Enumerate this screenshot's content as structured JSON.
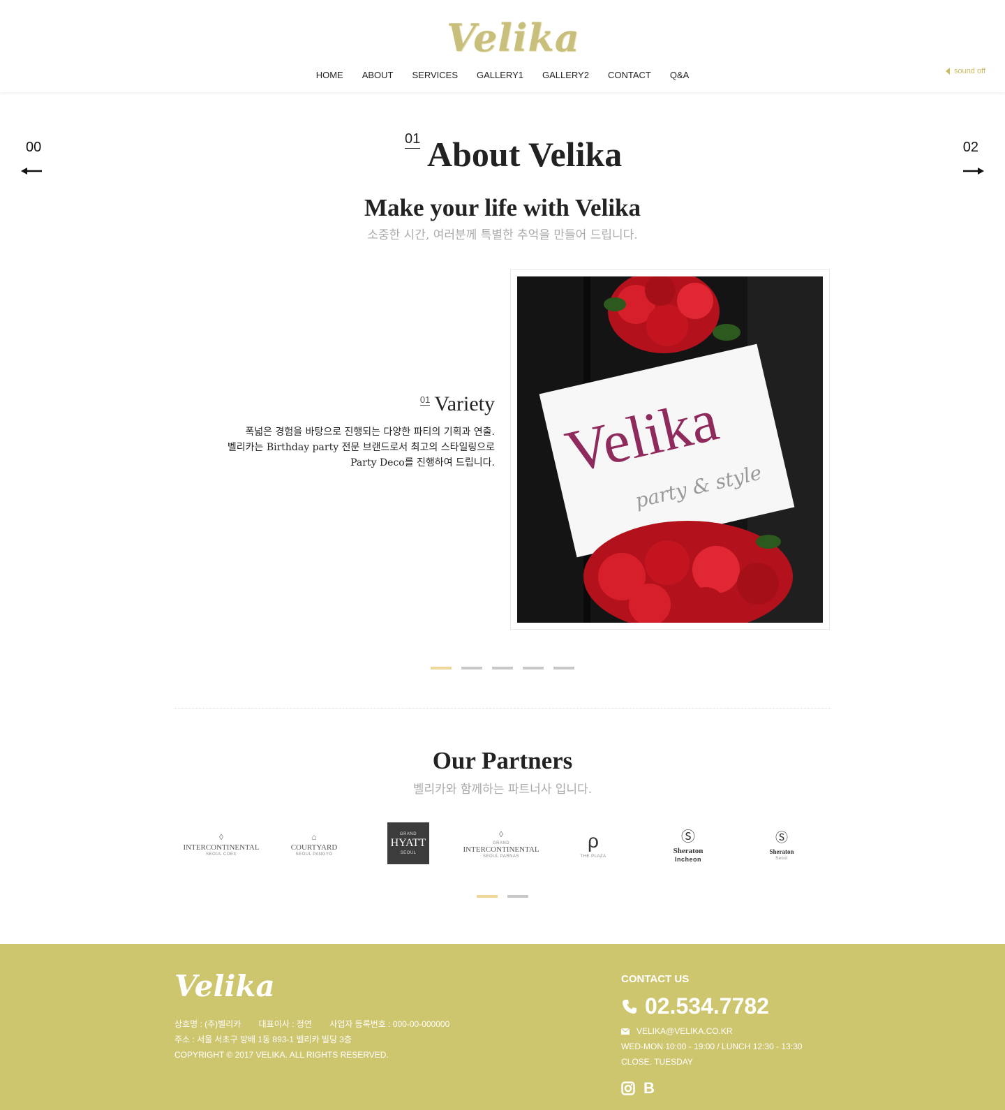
{
  "header": {
    "logo_text": "Velika",
    "nav": [
      "HOME",
      "ABOUT",
      "SERVICES",
      "GALLERY1",
      "GALLERY2",
      "CONTACT",
      "Q&A"
    ],
    "sound_label": "sound off"
  },
  "section_nav": {
    "prev_number": "00",
    "next_number": "02"
  },
  "about": {
    "index": "01",
    "title": "About Velika",
    "tagline": "Make your life with Velika",
    "subtagline": "소중한 시간, 여러분께 특별한 추억을 만들어 드립니다.",
    "feature": {
      "index": "01",
      "title": "Variety",
      "description": [
        "폭넓은 경험을 바탕으로 진행되는 다양한 파티의 기획과 연출.",
        "벨리카는 Birthday party 전문 브랜드로서 최고의 스타일링으로",
        "Party Deco를 진행하여 드립니다."
      ],
      "photo": {
        "sign_text": "Velika",
        "sign_subtext": "party & style"
      }
    },
    "slider": {
      "total": 5,
      "active": 1
    }
  },
  "partners": {
    "title": "Our Partners",
    "subtitle": "벨리카와 함께하는 파트너사 입니다.",
    "logos": [
      {
        "name": "INTERCONTINENTAL",
        "sub": "SEOUL COEX",
        "icon": "intercontinental-emblem-icon"
      },
      {
        "name": "COURTYARD",
        "sub": "SEOUL PANGYO",
        "icon": "courtyard-marriott-icon"
      },
      {
        "name": "HYATT",
        "sub": "SEOUL",
        "top": "GRAND",
        "icon": "grand-hyatt-icon"
      },
      {
        "name": "INTERCONTINENTAL",
        "sub": "SEOUL PARNAS",
        "top": "GRAND",
        "icon": "grand-intercontinental-icon"
      },
      {
        "name": "THE PLAZA",
        "sub": "",
        "icon": "the-plaza-icon"
      },
      {
        "name": "Sheraton",
        "sub": "Incheon",
        "icon": "sheraton-incheon-icon"
      },
      {
        "name": "Sheraton",
        "sub": "Seoul",
        "icon": "sheraton-seoul-icon"
      }
    ],
    "slider": {
      "total": 2,
      "active": 1
    }
  },
  "footer": {
    "logo_text": "Velika",
    "company": "상호명 : (주)벨리카",
    "ceo": "대표이사 : 정연",
    "registration": "사업자 등록번호 : 000-00-000000",
    "address": "주소 : 서울 서초구 방배 1동 893-1 벨리카 빌딩 3층",
    "copyright": "COPYRIGHT © 2017 VELIKA. ALL RIGHTS RESERVED.",
    "contact_title": "CONTACT US",
    "phone": "02.534.7782",
    "email": "VELIKA@VELIKA.CO.KR",
    "hours": "WED-MON 10:00 - 19:00 / LUNCH 12:30 - 13:30",
    "closed": "CLOSE. TUESDAY",
    "social": [
      "instagram-icon",
      "blog-icon"
    ],
    "blog_letter": "B"
  },
  "colors": {
    "gold": "#cec56f",
    "accent_dot": "#efd79a",
    "sound": "#c9bb5e"
  }
}
